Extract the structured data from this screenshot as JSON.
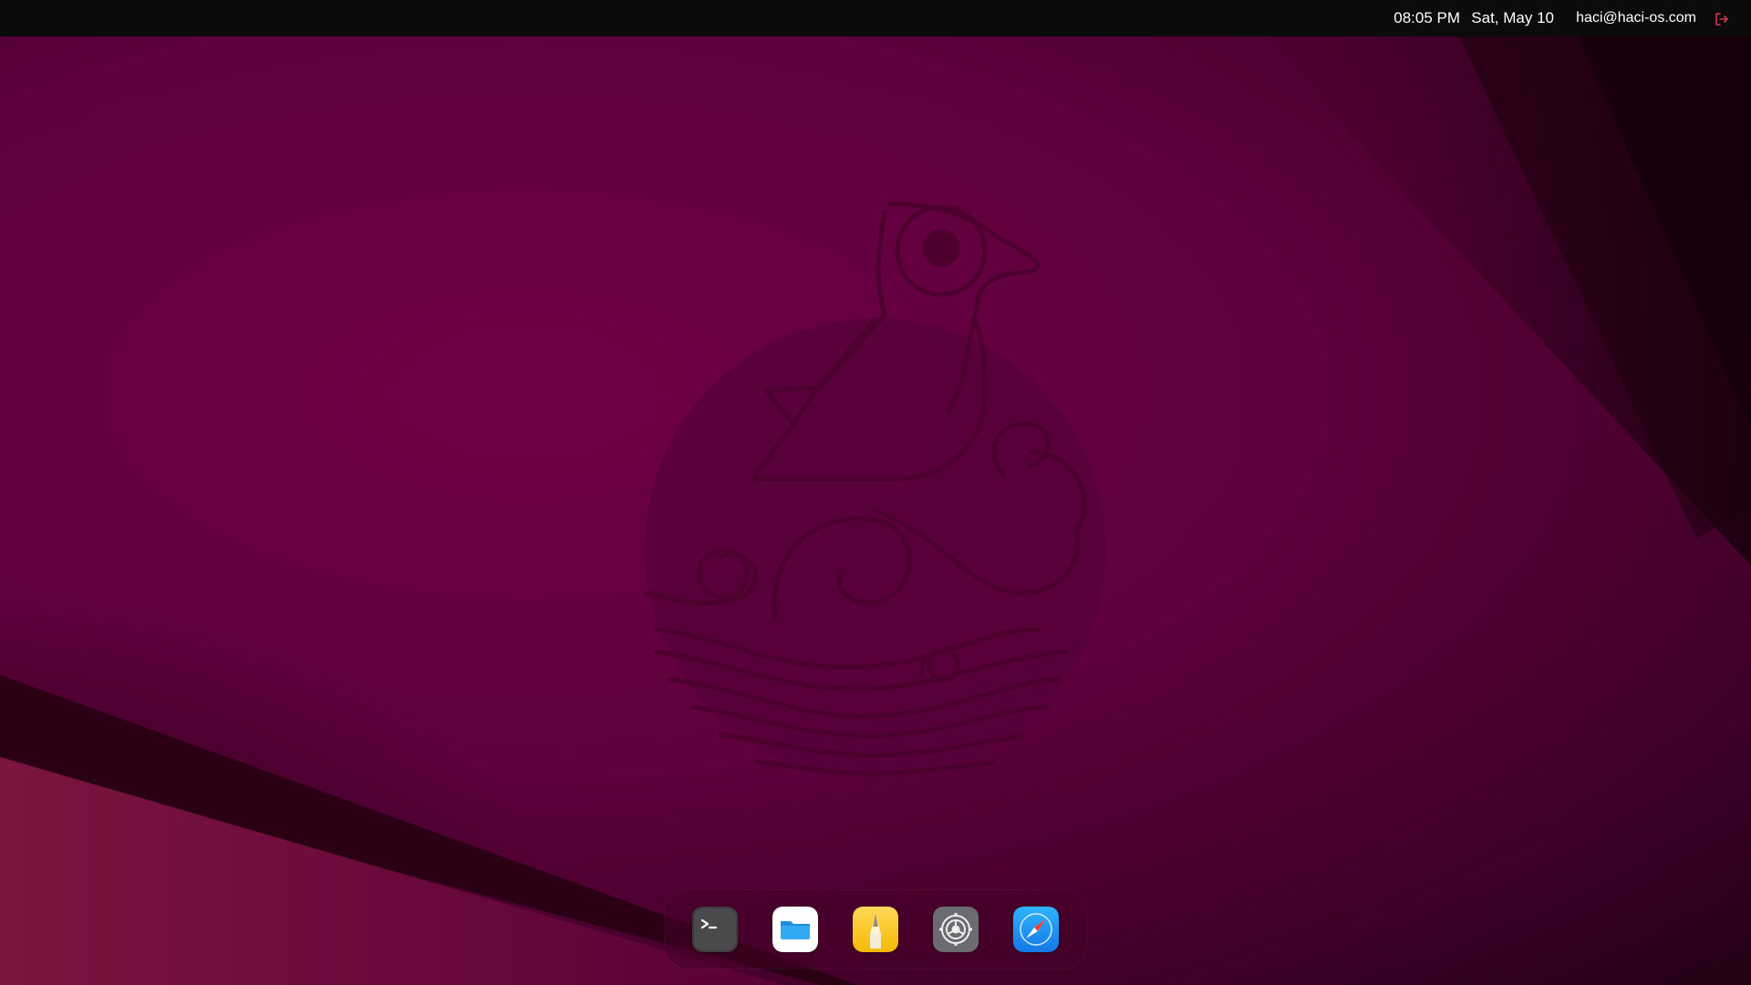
{
  "topbar": {
    "time": "08:05 PM",
    "date": "Sat, May 10",
    "user_email": "haci@haci-os.com",
    "logout_icon": "logout-icon",
    "logout_color": "#d23a4a"
  },
  "wallpaper": {
    "logo_icon": "puffin-logo",
    "colors": {
      "base": "#6e0045",
      "dark": "#2a0018",
      "accent": "#8a1a3a"
    }
  },
  "dock": {
    "items": [
      {
        "app": "terminal",
        "icon": "terminal-icon"
      },
      {
        "app": "files",
        "icon": "folder-icon"
      },
      {
        "app": "notes",
        "icon": "pen-icon"
      },
      {
        "app": "settings",
        "icon": "gear-icon"
      },
      {
        "app": "browser",
        "icon": "compass-icon"
      }
    ]
  }
}
